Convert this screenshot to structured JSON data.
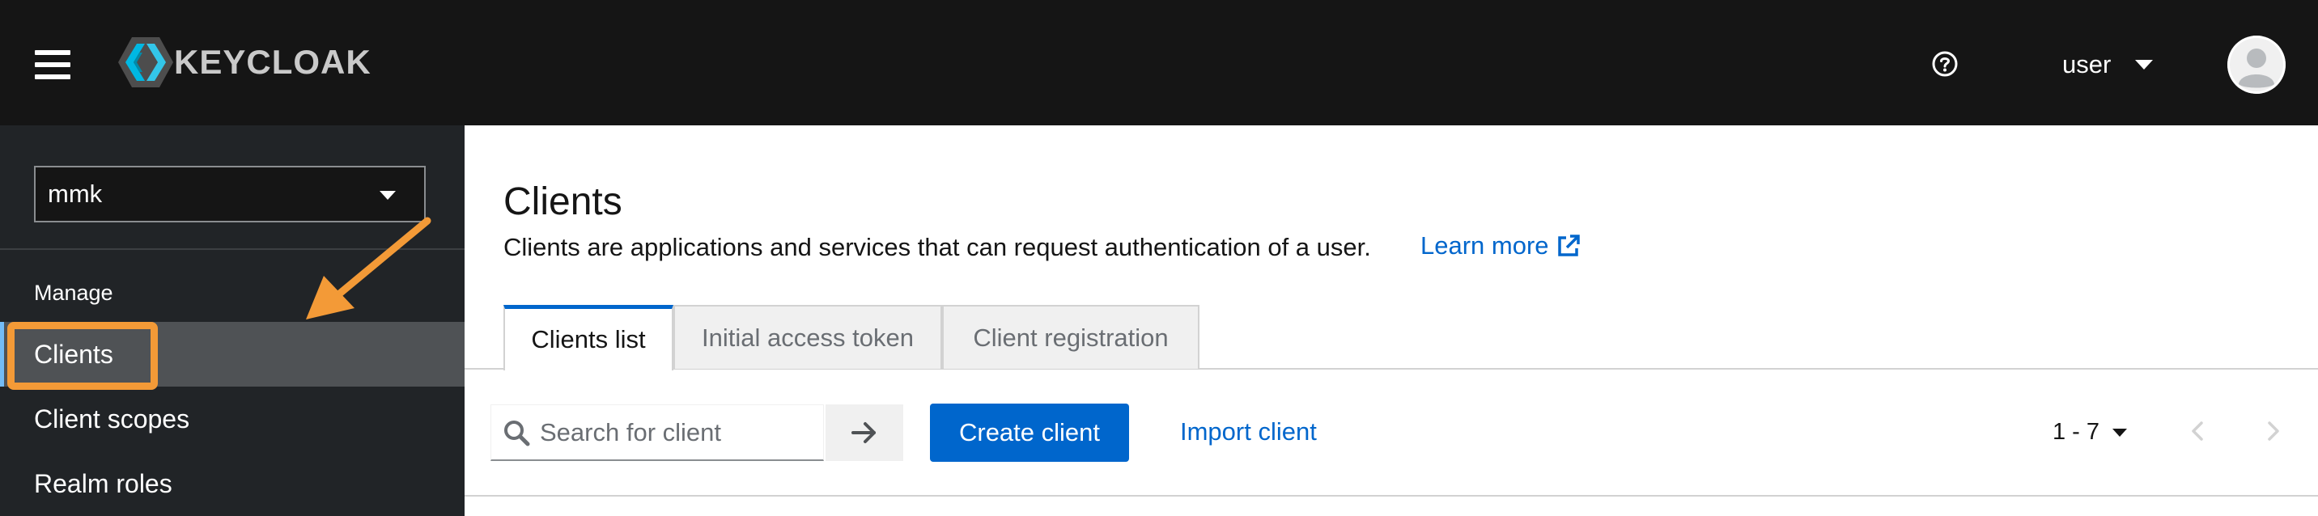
{
  "masthead": {
    "brand": "KEYCLOAK",
    "user_label": "user",
    "icons": {
      "menu": "hamburger-icon",
      "help": "help-icon",
      "avatar": "user-avatar-icon",
      "user_caret": "caret-down-icon"
    }
  },
  "sidebar": {
    "realm": "mmk",
    "section_label": "Manage",
    "items": [
      {
        "label": "Clients",
        "active": true
      },
      {
        "label": "Client scopes",
        "active": false
      },
      {
        "label": "Realm roles",
        "active": false
      }
    ]
  },
  "main": {
    "title": "Clients",
    "description": "Clients are applications and services that can request authentication of a user.",
    "learn_more": "Learn more",
    "tabs": [
      {
        "label": "Clients list",
        "active": true
      },
      {
        "label": "Initial access token",
        "active": false
      },
      {
        "label": "Client registration",
        "active": false
      }
    ]
  },
  "toolbar": {
    "search_placeholder": "Search for client",
    "create_label": "Create client",
    "import_label": "Import client",
    "pagination": "1 - 7"
  },
  "colors": {
    "masthead": "#151515",
    "sidebar": "#212427",
    "primary": "#0066cc",
    "annotation": "#f39a37"
  }
}
